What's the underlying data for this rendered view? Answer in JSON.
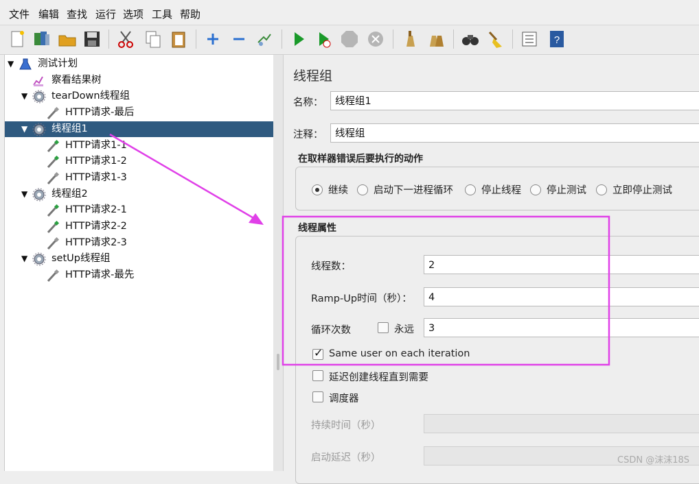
{
  "menu": [
    "文件",
    "编辑",
    "查找",
    "运行",
    "选项",
    "工具",
    "帮助"
  ],
  "toolbar": {
    "icons": [
      "new-icon",
      "templates-icon",
      "open-icon",
      "save-icon",
      "cut-icon",
      "copy-icon",
      "paste-icon",
      "expand-icon",
      "collapse-icon",
      "toggle-icon",
      "start-icon",
      "start-no-pause-icon",
      "stop-icon",
      "shutdown-icon",
      "clear-icon",
      "clear-all-icon",
      "search-icon",
      "reset-search-icon",
      "function-helper-icon",
      "help-icon"
    ]
  },
  "tree": {
    "nodes": [
      {
        "label": "测试计划",
        "level": 0,
        "toggle": "▼",
        "icon": "flask-icon"
      },
      {
        "label": "察看结果树",
        "level": 1,
        "toggle": "",
        "icon": "chart-icon"
      },
      {
        "label": "tearDown线程组",
        "level": 1,
        "toggle": "▼",
        "icon": "gear-icon"
      },
      {
        "label": "HTTP请求-最后",
        "level": 2,
        "toggle": "",
        "icon": "pipette-icon"
      },
      {
        "label": "线程组1",
        "level": 1,
        "toggle": "▼",
        "icon": "gear-icon",
        "selected": true
      },
      {
        "label": "HTTP请求1-1",
        "level": 2,
        "toggle": "",
        "icon": "pipette-green-icon"
      },
      {
        "label": "HTTP请求1-2",
        "level": 2,
        "toggle": "",
        "icon": "pipette-green-icon"
      },
      {
        "label": "HTTP请求1-3",
        "level": 2,
        "toggle": "",
        "icon": "pipette-icon"
      },
      {
        "label": "线程组2",
        "level": 1,
        "toggle": "▼",
        "icon": "gear-icon"
      },
      {
        "label": "HTTP请求2-1",
        "level": 2,
        "toggle": "",
        "icon": "pipette-green-icon"
      },
      {
        "label": "HTTP请求2-2",
        "level": 2,
        "toggle": "",
        "icon": "pipette-green-icon"
      },
      {
        "label": "HTTP请求2-3",
        "level": 2,
        "toggle": "",
        "icon": "pipette-icon"
      },
      {
        "label": "setUp线程组",
        "level": 1,
        "toggle": "▼",
        "icon": "gear-icon"
      },
      {
        "label": "HTTP请求-最先",
        "level": 2,
        "toggle": "",
        "icon": "pipette-icon"
      }
    ]
  },
  "panel": {
    "title": "线程组",
    "name_label": "名称：",
    "name_value": "线程组1",
    "comment_label": "注释：",
    "comment_value": "线程组",
    "error_group_title": "在取样器错误后要执行的动作",
    "error_options": [
      "继续",
      "启动下一进程循环",
      "停止线程",
      "停止测试",
      "立即停止测试"
    ],
    "error_selected": 0,
    "props_title": "线程属性",
    "threads_label": "线程数：",
    "threads_value": "2",
    "rampup_label": "Ramp-Up时间（秒）：",
    "rampup_value": "4",
    "loop_label": "循环次数",
    "forever_label": "永远",
    "forever_checked": false,
    "loop_value": "3",
    "same_user_label": "Same user on each iteration",
    "same_user_checked": true,
    "delay_label": "延迟创建线程直到需要",
    "delay_checked": false,
    "scheduler_label": "调度器",
    "scheduler_checked": false,
    "duration_label": "持续时间（秒）",
    "startup_delay_label": "启动延迟（秒）"
  },
  "annotation_color": "#e040e8",
  "selection_color": "#2f5a80",
  "watermark": "CSDN @沫沫18S"
}
